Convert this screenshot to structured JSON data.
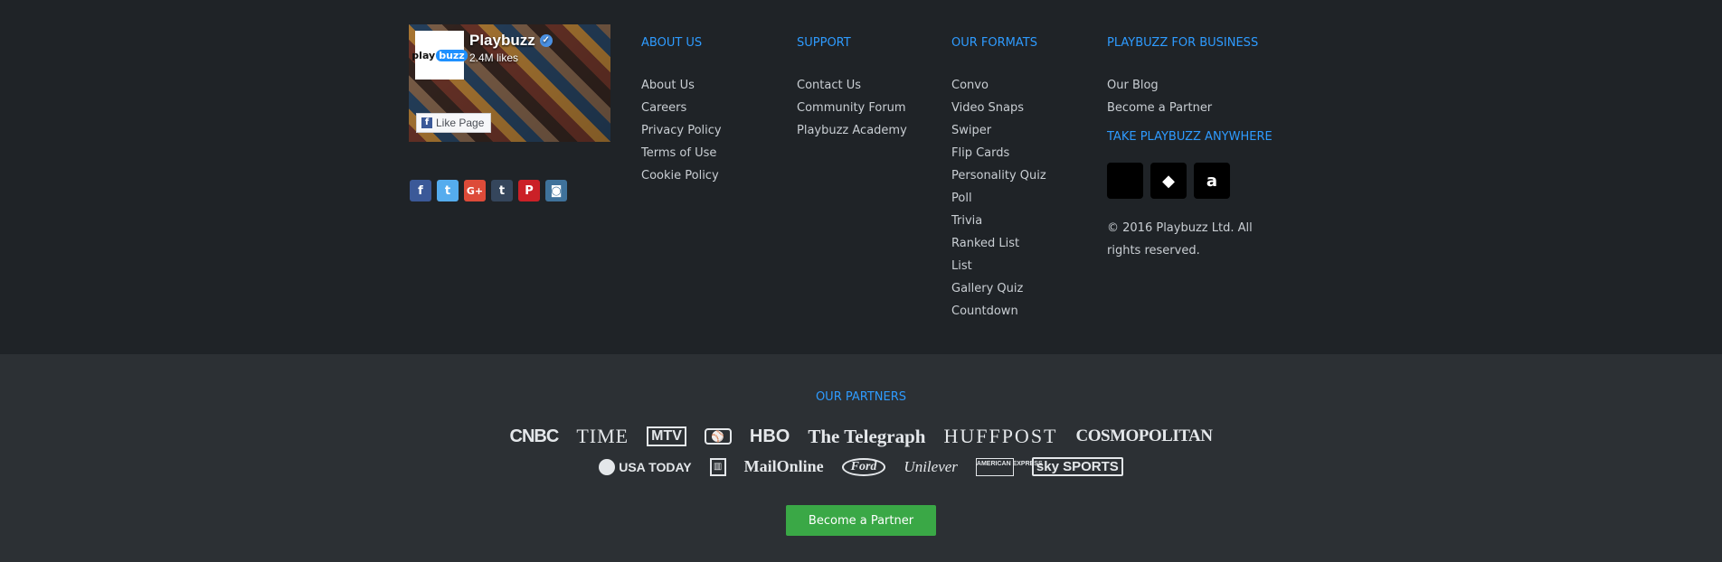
{
  "facebook": {
    "page_name": "Playbuzz",
    "logo_text": "playbuzz",
    "likes": "2.4M likes",
    "like_button": "Like Page"
  },
  "social_icons": [
    {
      "name": "facebook-icon",
      "glyph": "f",
      "color": "#3b5998"
    },
    {
      "name": "twitter-icon",
      "glyph": "t",
      "color": "#55acee"
    },
    {
      "name": "google-plus-icon",
      "glyph": "G+",
      "color": "#dd4b39"
    },
    {
      "name": "tumblr-icon",
      "glyph": "t",
      "color": "#35465c"
    },
    {
      "name": "pinterest-icon",
      "glyph": "P",
      "color": "#cb2027"
    },
    {
      "name": "instagram-icon",
      "glyph": "◙",
      "color": "#3f729b"
    }
  ],
  "about": {
    "title": "ABOUT US",
    "items": [
      "About Us",
      "Careers",
      "Privacy Policy",
      "Terms of Use",
      "Cookie Policy"
    ]
  },
  "support": {
    "title": "SUPPORT",
    "items": [
      "Contact Us",
      "Community Forum",
      "Playbuzz Academy"
    ]
  },
  "formats": {
    "title": "OUR FORMATS",
    "items": [
      "Convo",
      "Video Snaps",
      "Swiper",
      "Flip Cards",
      "Personality Quiz",
      "Poll",
      "Trivia",
      "Ranked List",
      "List",
      "Gallery Quiz",
      "Countdown"
    ]
  },
  "business": {
    "title": "PLAYBUZZ FOR BUSINESS",
    "items": [
      "Our Blog",
      "Become a Partner"
    ],
    "anywhere_title": "TAKE PLAYBUZZ ANYWHERE",
    "stores": [
      {
        "name": "apple-icon",
        "glyph": ""
      },
      {
        "name": "android-icon",
        "glyph": "◆"
      },
      {
        "name": "amazon-icon",
        "glyph": "a"
      }
    ],
    "copyright": "© 2016 Playbuzz Ltd. All rights reserved."
  },
  "partners": {
    "title": "OUR PARTNERS",
    "row1": [
      "CNBC",
      "TIME",
      "MTV",
      "MLB",
      "HBO",
      "The Telegraph",
      "HUFFPOST",
      "COSMOPOLITAN"
    ],
    "row2": [
      "USA TODAY",
      "BuzzFeed",
      "MailOnline",
      "Ford",
      "Unilever",
      "AMERICAN EXPRESS",
      "sky SPORTS"
    ],
    "button": "Become a Partner"
  },
  "colors": {
    "accent": "#2e9bff",
    "button_green": "#3aa846",
    "footer_top": "#1f2327",
    "footer_bottom": "#2c3034"
  }
}
